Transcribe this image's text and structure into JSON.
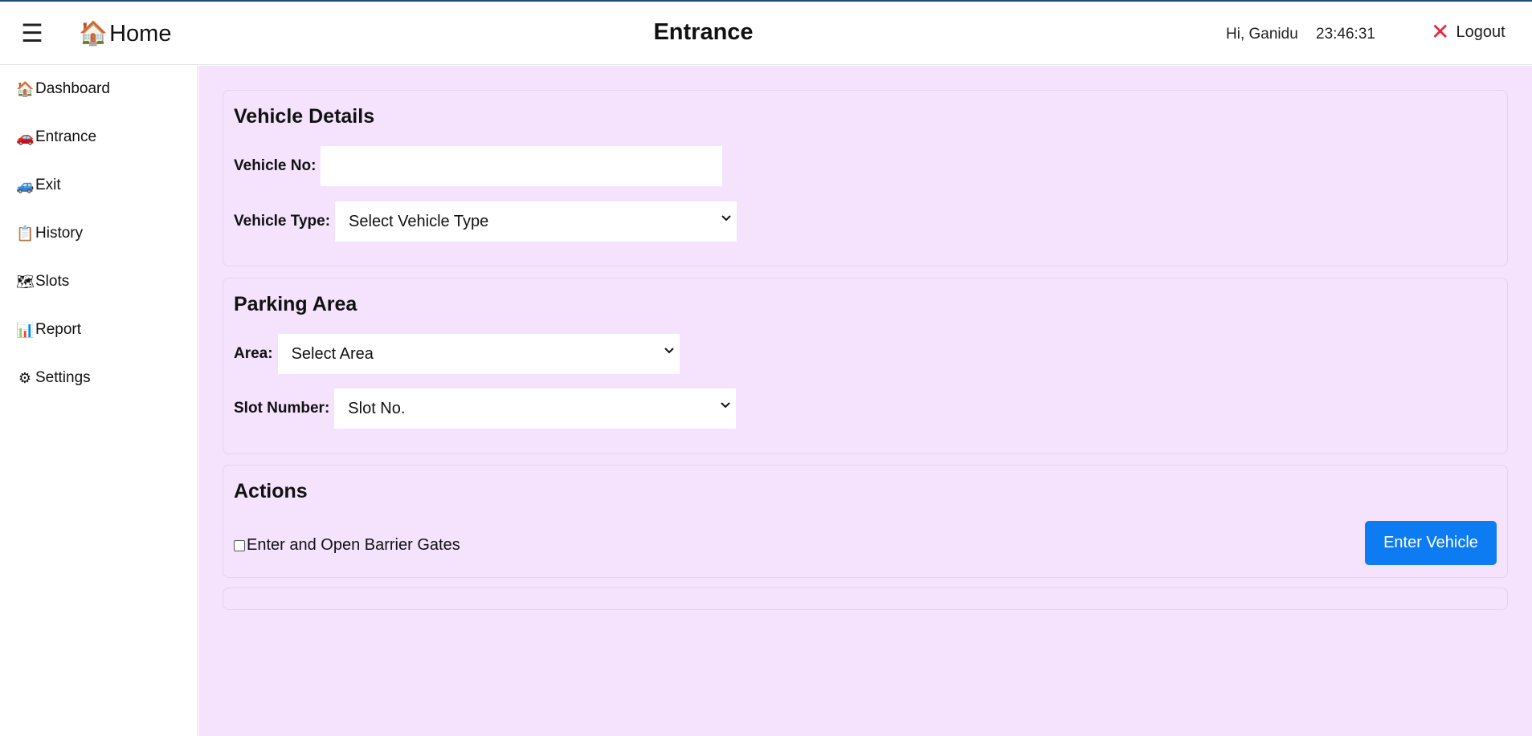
{
  "header": {
    "menu_icon": "hamburger-icon",
    "home_icon": "house-icon",
    "home_label": "Home",
    "title": "Entrance",
    "greeting": "Hi, Ganidu",
    "clock": "23:46:31",
    "logout_icon": "close-icon",
    "logout_label": "Logout"
  },
  "sidebar": {
    "items": [
      {
        "label": "Dashboard",
        "icon": "house-icon"
      },
      {
        "label": "Entrance",
        "icon": "car-icon"
      },
      {
        "label": "Exit",
        "icon": "car-exit-icon"
      },
      {
        "label": "History",
        "icon": "clipboard-icon"
      },
      {
        "label": "Slots",
        "icon": "map-icon"
      },
      {
        "label": "Report",
        "icon": "bar-chart-icon"
      },
      {
        "label": "Settings",
        "icon": "gear-icon"
      }
    ]
  },
  "vehicle_details": {
    "title": "Vehicle Details",
    "vehicle_no_label": "Vehicle No:",
    "vehicle_no_value": "",
    "vehicle_type_label": "Vehicle Type:",
    "vehicle_type_selected": "Select Vehicle Type"
  },
  "parking_area": {
    "title": "Parking Area",
    "area_label": "Area:",
    "area_selected": "Select Area",
    "slot_label": "Slot Number:",
    "slot_selected": "Slot No."
  },
  "actions": {
    "title": "Actions",
    "checkbox_label": "Enter and Open Barrier Gates",
    "checkbox_checked": false,
    "enter_button": "Enter Vehicle"
  },
  "colors": {
    "main_background": "#f5e3fd",
    "primary_button": "#0d7bf2",
    "logout_icon": "#e8263d"
  }
}
